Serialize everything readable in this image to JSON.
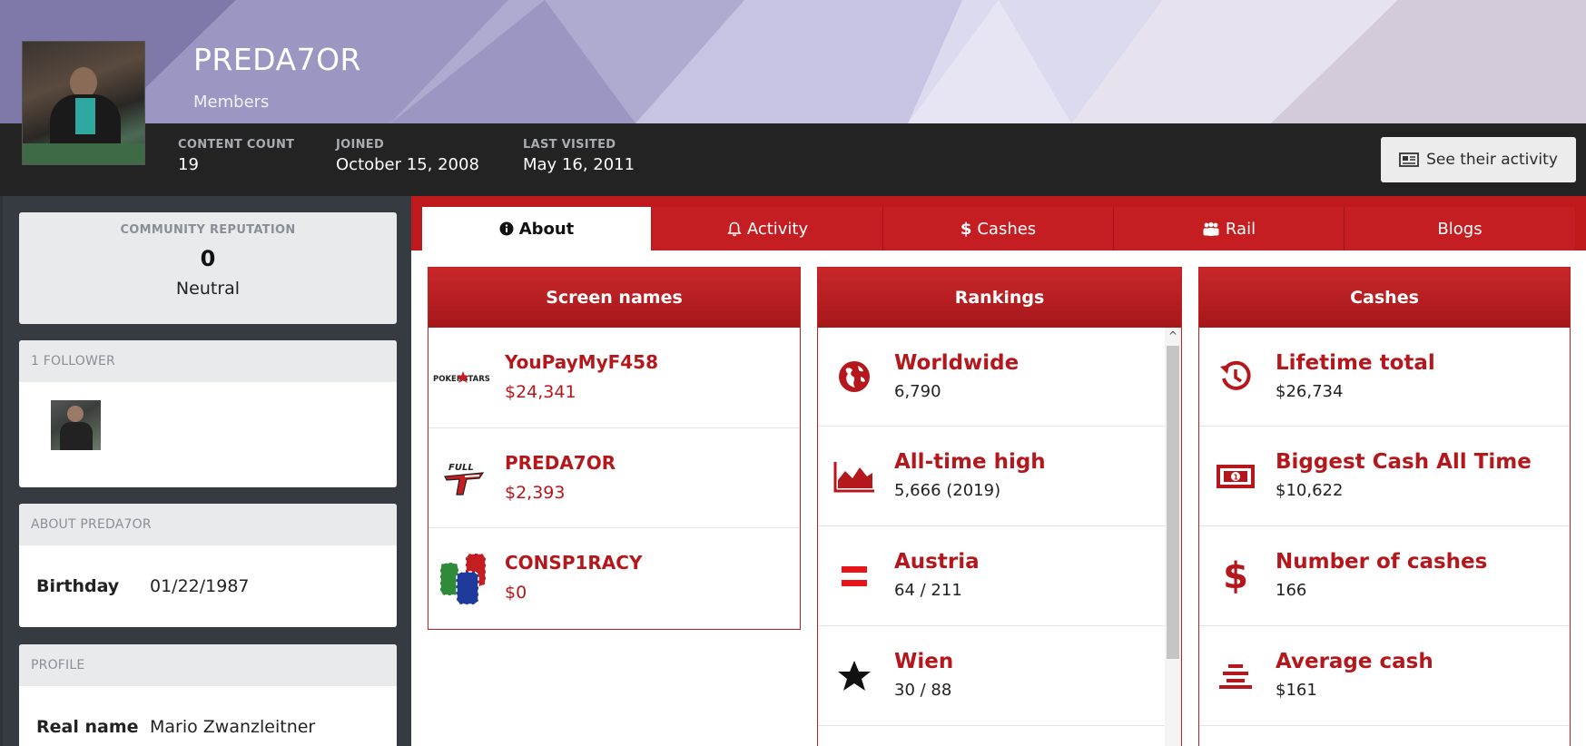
{
  "profile": {
    "name": "PREDA7OR",
    "group": "Members",
    "stats": [
      {
        "label": "CONTENT COUNT",
        "value": "19"
      },
      {
        "label": "JOINED",
        "value": "October 15, 2008"
      },
      {
        "label": "LAST VISITED",
        "value": "May 16, 2011"
      }
    ],
    "activity_button": "See their activity"
  },
  "sidebar": {
    "reputation": {
      "label": "COMMUNITY REPUTATION",
      "value": "0",
      "word": "Neutral"
    },
    "followers": {
      "label": "1 FOLLOWER"
    },
    "about": {
      "label": "ABOUT PREDA7OR",
      "key": "Birthday",
      "value": "01/22/1987"
    },
    "profile": {
      "label": "PROFILE",
      "key": "Real name",
      "value": "Mario Zwanzleitner"
    }
  },
  "tabs": [
    {
      "label": "About",
      "icon": "info-icon",
      "active": true
    },
    {
      "label": "Activity",
      "icon": "bell-icon",
      "active": false
    },
    {
      "label": "Cashes",
      "icon": "dollar-icon",
      "active": false
    },
    {
      "label": "Rail",
      "icon": "users-icon",
      "active": false
    },
    {
      "label": "Blogs",
      "icon": "",
      "active": false
    }
  ],
  "screen_names": {
    "title": "Screen names",
    "items": [
      {
        "site": "POKERSTARS",
        "name": "YouPayMyF458",
        "amount": "$24,341",
        "icon": "pokerstars-logo"
      },
      {
        "site": "FULL TILT",
        "name": "PREDA7OR",
        "amount": "$2,393",
        "icon": "fulltilt-logo"
      },
      {
        "site": "",
        "name": "CONSP1RACY",
        "amount": "$0",
        "icon": "poker-chips-icon"
      }
    ]
  },
  "rankings": {
    "title": "Rankings",
    "items": [
      {
        "label": "Worldwide",
        "value": "6,790",
        "icon": "globe-icon"
      },
      {
        "label": "All-time high",
        "value": "5,666 (2019)",
        "icon": "area-chart-icon"
      },
      {
        "label": "Austria",
        "value": "64 / 211",
        "icon": "austria-flag-icon"
      },
      {
        "label": "Wien",
        "value": "30 / 88",
        "icon": "star-icon"
      }
    ]
  },
  "cashes": {
    "title": "Cashes",
    "items": [
      {
        "label": "Lifetime total",
        "value": "$26,734",
        "icon": "history-icon"
      },
      {
        "label": "Biggest Cash All Time",
        "value": "$10,622",
        "icon": "banknote-icon"
      },
      {
        "label": "Number of cashes",
        "value": "166",
        "icon": "dollar-icon"
      },
      {
        "label": "Average cash",
        "value": "$161",
        "icon": "stack-icon"
      }
    ]
  },
  "colors": {
    "brand_red": "#c41e22",
    "accent_text": "#b4181c",
    "dark_bar": "#232323"
  }
}
